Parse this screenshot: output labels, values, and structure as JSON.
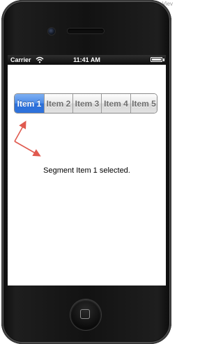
{
  "background_label": "Viev",
  "status_bar": {
    "carrier": "Carrier",
    "time": "11:41 AM"
  },
  "segmented_control": {
    "items": [
      "Item 1",
      "Item 2",
      "Item 3",
      "Item 4",
      "Item 5"
    ],
    "selected_index": 0
  },
  "message": "Segment Item 1 selected.",
  "colors": {
    "selected_segment": "#3f7fe0",
    "arrow": "#e05a4f"
  }
}
